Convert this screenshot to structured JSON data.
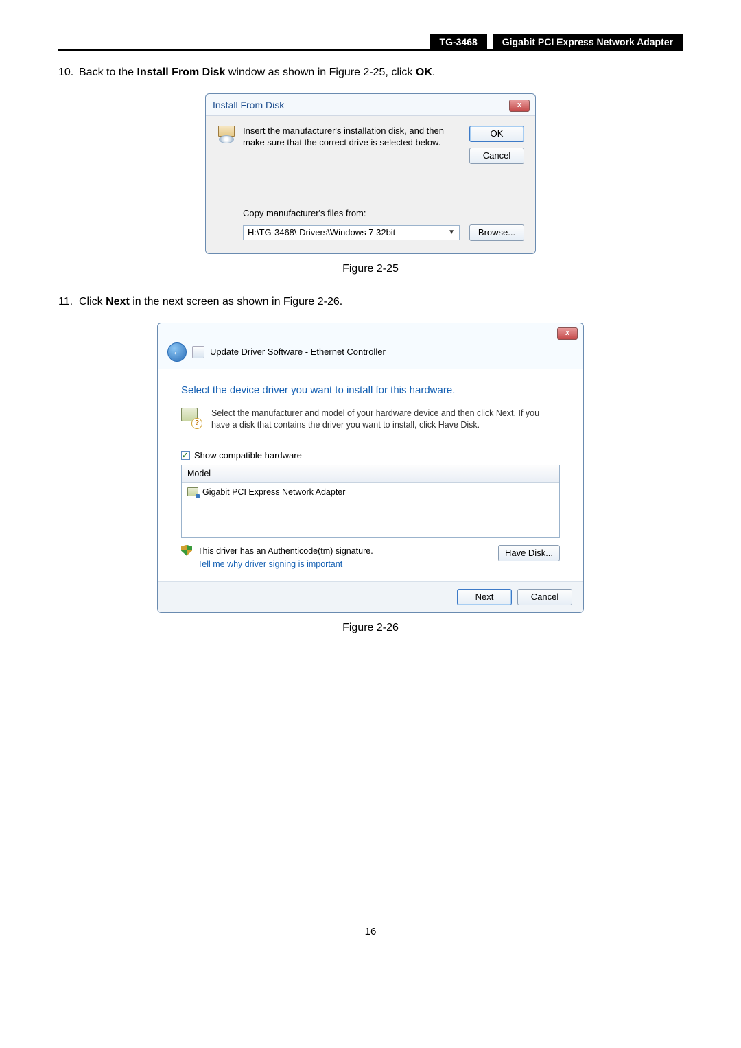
{
  "header": {
    "model": "TG-3468",
    "product": "Gigabit PCI Express Network Adapter"
  },
  "step10": {
    "num": "10.",
    "prefix": "Back to the ",
    "bold1": "Install From Disk",
    "mid": " window as shown in Figure 2-25, click ",
    "bold2": "OK",
    "suffix": "."
  },
  "dlg1": {
    "title": "Install From Disk",
    "close": "x",
    "msg": "Insert the manufacturer's installation disk, and then make sure that the correct drive is selected below.",
    "ok": "OK",
    "cancel": "Cancel",
    "copyLabel": "Copy manufacturer's files from:",
    "path": "H:\\TG-3468\\ Drivers\\Windows 7 32bit",
    "browse": "Browse..."
  },
  "figcap1": "Figure 2-25",
  "step11": {
    "num": "11.",
    "prefix": "Click ",
    "bold1": "Next",
    "suffix": " in the next screen as shown in Figure 2-26."
  },
  "dlg2": {
    "close": "x",
    "back": "←",
    "title": "Update Driver Software - Ethernet Controller",
    "heading": "Select the device driver you want to install for this hardware.",
    "instr": "Select the manufacturer and model of your hardware device and then click Next. If you have a disk that contains the driver you want to install, click Have Disk.",
    "showCompatible": "Show compatible hardware",
    "modelHeader": "Model",
    "modelItem": "Gigabit PCI Express Network Adapter",
    "authText": "This driver has an Authenticode(tm) signature.",
    "authLink": "Tell me why driver signing is important",
    "haveDisk": "Have Disk...",
    "next": "Next",
    "cancel": "Cancel"
  },
  "figcap2": "Figure 2-26",
  "pageNum": "16"
}
